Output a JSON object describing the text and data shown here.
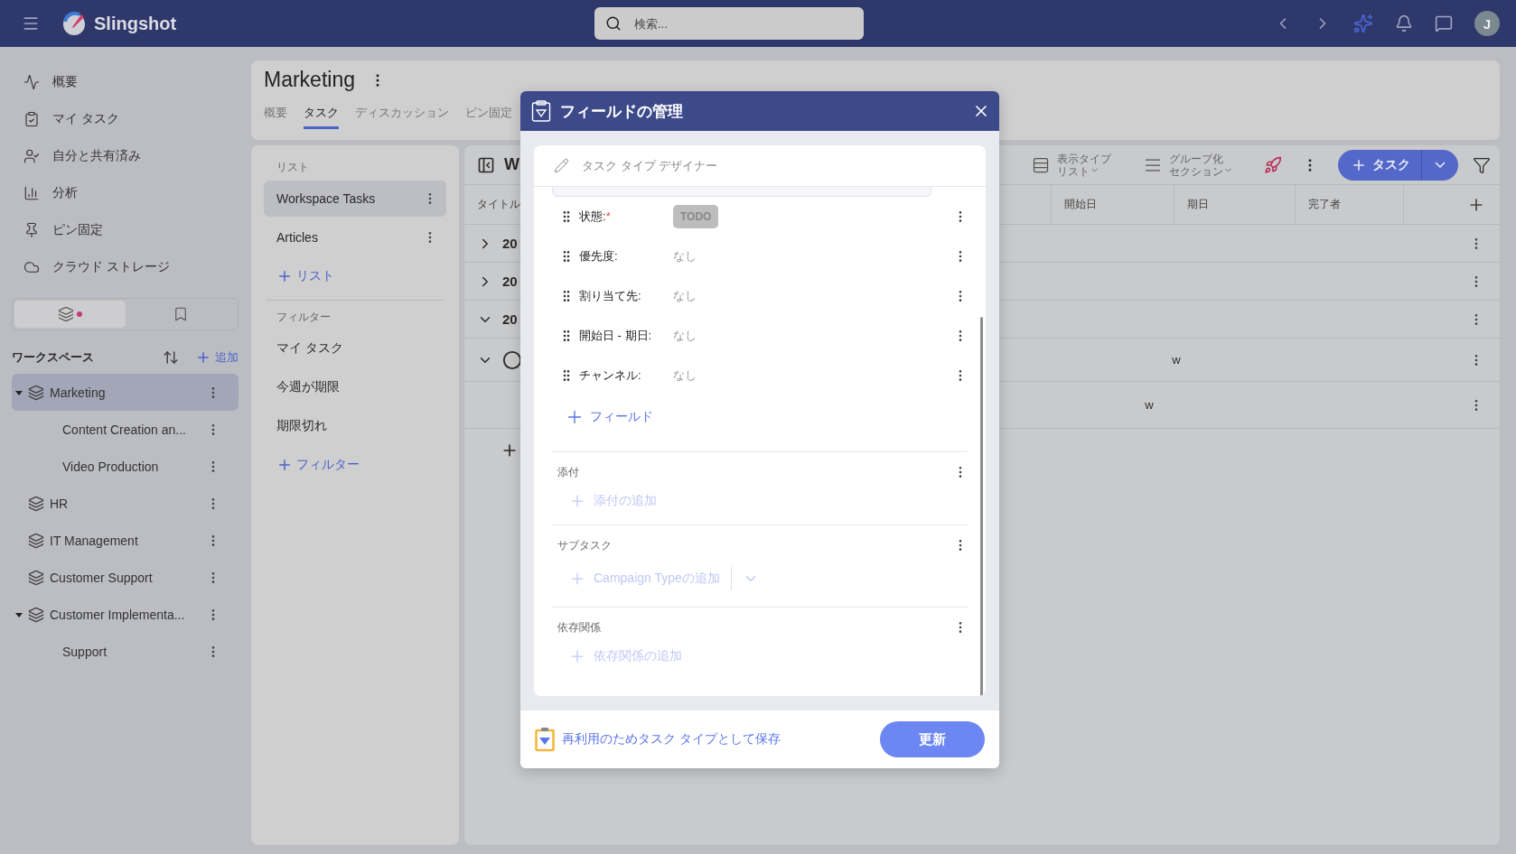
{
  "topbar": {
    "app_name": "Slingshot",
    "search": {
      "placeholder": "検索..."
    },
    "avatar": "J"
  },
  "nav": [
    {
      "label": "概要"
    },
    {
      "label": "マイ タスク"
    },
    {
      "label": "自分と共有済み"
    },
    {
      "label": "分析"
    },
    {
      "label": "ピン固定"
    },
    {
      "label": "クラウド ストレージ"
    }
  ],
  "sidebar_tabs": [
    {
      "selected": true,
      "dot": true
    },
    {
      "selected": false,
      "dot": false
    }
  ],
  "workspaces": {
    "title": "ワークスペース",
    "add": "追加",
    "items": [
      {
        "name": "Marketing",
        "selected": true,
        "expanded": true,
        "children": [
          {
            "name": "Content Creation an...",
            "selected": false
          },
          {
            "name": "Video Production",
            "selected": false
          }
        ]
      },
      {
        "name": "HR",
        "selected": false
      },
      {
        "name": "IT Management",
        "selected": false
      },
      {
        "name": "Customer Support",
        "selected": false
      },
      {
        "name": "Customer Implementa...",
        "selected": false,
        "expanded": true,
        "children": [
          {
            "name": "Support",
            "selected": false
          }
        ]
      }
    ]
  },
  "project": {
    "title": "Marketing",
    "tabs": [
      {
        "label": "概要",
        "selected": false
      },
      {
        "label": "タスク",
        "selected": true
      },
      {
        "label": "ディスカッション",
        "selected": false
      },
      {
        "label": "ピン固定",
        "selected": false
      }
    ]
  },
  "lists": {
    "heading": "リスト",
    "items": [
      {
        "name": "Workspace Tasks",
        "selected": true
      },
      {
        "name": "Articles",
        "selected": false
      }
    ],
    "add": "リスト"
  },
  "filters": {
    "heading": "フィルター",
    "items": [
      "マイ タスク",
      "今週が期限",
      "期限切れ"
    ],
    "add": "フィルター"
  },
  "toolbar": {
    "list_title": "W",
    "view_type": {
      "label": "表示タイプ",
      "value": "リスト"
    },
    "group_by": {
      "label": "グループ化",
      "value": "セクション"
    },
    "add_task": "タスク"
  },
  "table": {
    "columns": [
      "タイトル",
      "開始日",
      "期日",
      "完了者"
    ],
    "rows": [
      {
        "kind": "group",
        "expanded": false,
        "title": "20"
      },
      {
        "kind": "group",
        "expanded": false,
        "title": "20"
      },
      {
        "kind": "group",
        "expanded": true,
        "title": "20"
      },
      {
        "kind": "task",
        "expanded": true,
        "title": "w"
      },
      {
        "kind": "subtask",
        "title": "w"
      }
    ]
  },
  "modal": {
    "title": "フィールドの管理",
    "designer": {
      "placeholder": "タスク タイプ デザイナー"
    },
    "fields": [
      {
        "kind": "status",
        "label": "状態:",
        "required_mark": "*",
        "value": "TODO"
      },
      {
        "kind": "text",
        "label": "優先度:",
        "value": "なし"
      },
      {
        "kind": "text",
        "label": "割り当て先:",
        "value": "なし"
      },
      {
        "kind": "text",
        "label": "開始日 - 期日:",
        "value": "なし"
      },
      {
        "kind": "text",
        "label": "チャンネル:",
        "value": "なし"
      }
    ],
    "add_field": "フィールド",
    "sections": [
      {
        "kind": "plain",
        "title": "添付",
        "add": "添付の追加"
      },
      {
        "kind": "split",
        "title": "サブタスク",
        "add": "Campaign Typeの追加"
      },
      {
        "kind": "plain",
        "title": "依存関係",
        "add": "依存関係の追加"
      }
    ],
    "save_link": "再利用のためタスク タイプとして保存",
    "submit": "更新"
  }
}
